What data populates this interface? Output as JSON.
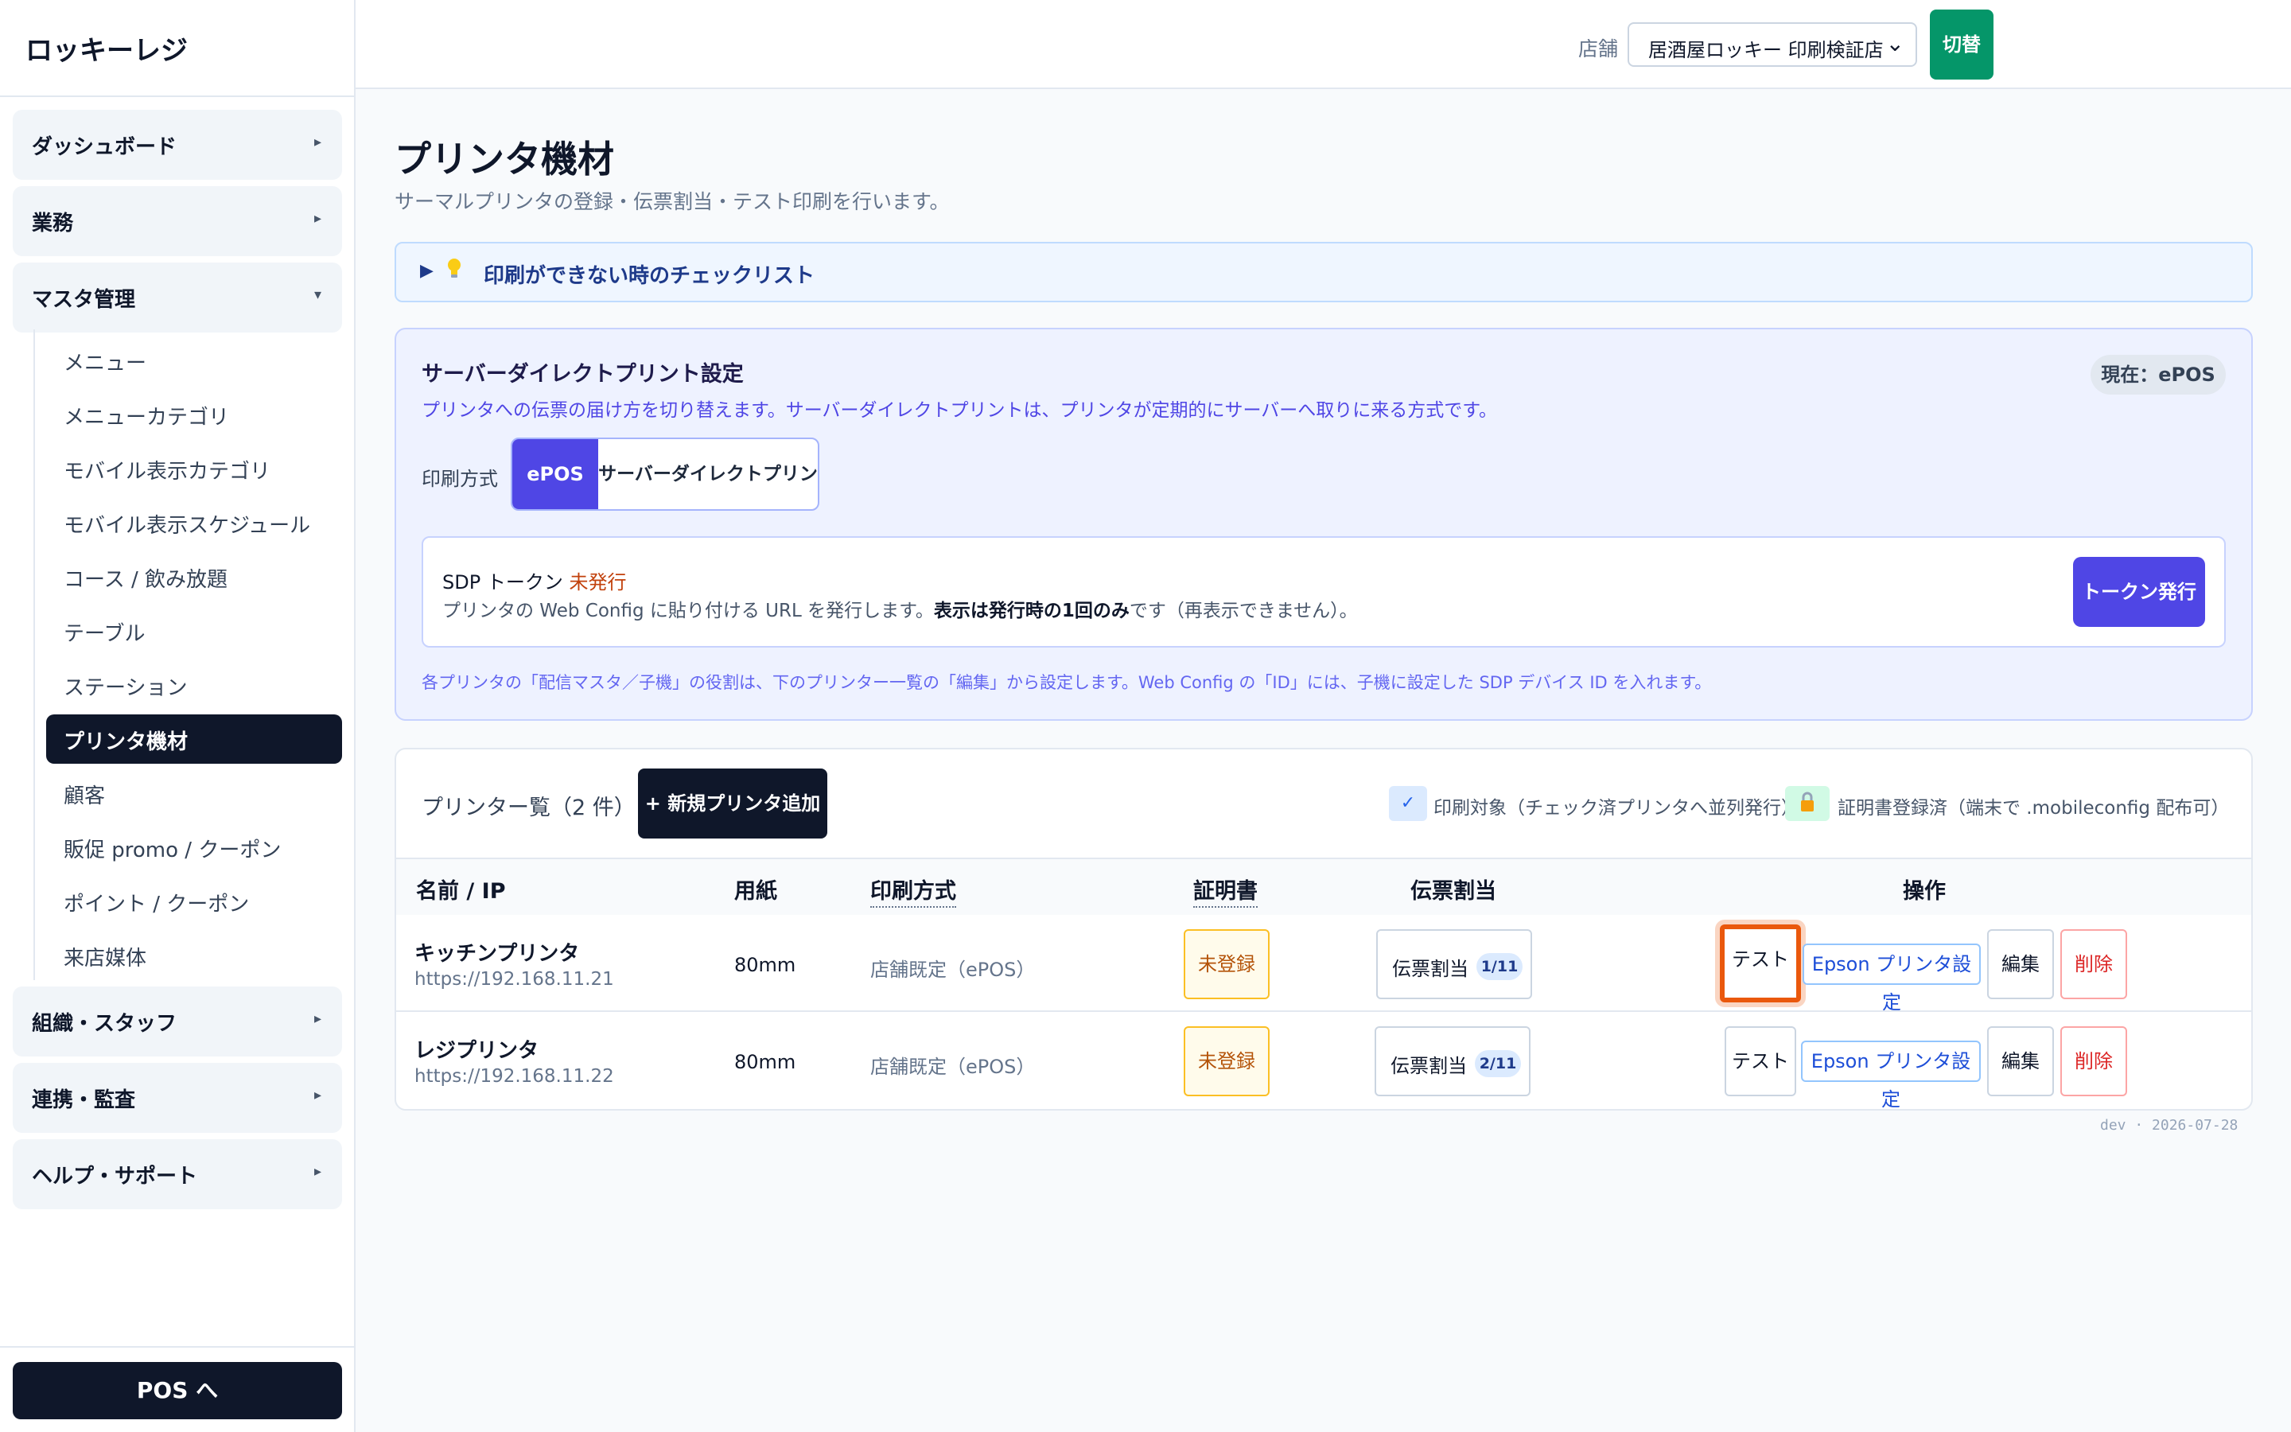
{
  "sidebar": {
    "brand": "ロッキーレジ",
    "groups": [
      {
        "label": "ダッシュボード",
        "arrow": "▸"
      },
      {
        "label": "業務",
        "arrow": "▸"
      },
      {
        "label": "マスタ管理",
        "arrow": "▾"
      },
      {
        "label": "組織・スタッフ",
        "arrow": "▸"
      },
      {
        "label": "連携・監査",
        "arrow": "▸"
      },
      {
        "label": "ヘルプ・サポート",
        "arrow": "▸"
      }
    ],
    "master_items": [
      "メニュー",
      "メニューカテゴリ",
      "モバイル表示カテゴリ",
      "モバイル表示スケジュール",
      "コース / 飲み放題",
      "テーブル",
      "ステーション",
      "プリンタ機材",
      "顧客",
      "販促 promo / クーポン",
      "ポイント / クーポン",
      "来店媒体"
    ],
    "active_item": "プリンタ機材",
    "pos_button": "POS へ"
  },
  "topbar": {
    "store_label": "店舗",
    "store_value": "居酒屋ロッキー 印刷検証店",
    "store_chevron": "⌄",
    "switch_button": "切替"
  },
  "page": {
    "title": "プリンタ機材",
    "subtitle": "サーマルプリンタの登録・伝票割当・テスト印刷を行います。"
  },
  "checklist": {
    "toggle": "▶",
    "label": "印刷ができない時のチェックリスト",
    "icon": "lightbulb-icon"
  },
  "sdp": {
    "title": "サーバーダイレクトプリント設定",
    "description": "プリンタへの伝票の届け方を切り替えます。サーバーダイレクトプリントは、プリンタが定期的にサーバーへ取りに来る方式です。",
    "current_badge": "現在：ePOS",
    "mode_label": "印刷方式",
    "mode_options": [
      "ePOS",
      "サーバーダイレクトプリント"
    ],
    "mode_selected": "ePOS",
    "token_title": "SDP トークン",
    "token_status": "未発行",
    "token_desc_1": "プリンタの Web Config に貼り付ける URL を発行します。",
    "token_desc_bold": "表示は発行時の1回のみ",
    "token_desc_2": "です（再表示できません）。",
    "token_button": "トークン発行",
    "note": "各プリンタの「配信マスタ／子機」の役割は、下のプリンター一覧の「編集」から設定します。Web Config の「ID」には、子機に設定した SDP デバイス ID を入れます。"
  },
  "printer_list": {
    "title": "プリンター覧（2 件）",
    "add_button": "+ 新規プリンタ追加",
    "legend_print": "印刷対象（チェック済プリンタへ並列発行）",
    "legend_print_icon": "✓",
    "legend_cert": "証明書登録済（端末で .mobileconfig 配布可）",
    "legend_cert_icon": "lock-icon",
    "headers": {
      "name": "名前 / IP",
      "paper": "用紙",
      "method": "印刷方式",
      "cert": "証明書",
      "assign": "伝票割当",
      "ops": "操作"
    },
    "rows": [
      {
        "name": "キッチンプリンタ",
        "ip": "https://192.168.11.21",
        "paper": "80mm",
        "method": "店舗既定（ePOS）",
        "cert": "未登録",
        "assign_label": "伝票割当",
        "assign_count": "1/11",
        "test": "テスト",
        "epson": "Epson プリンタ設定",
        "edit": "編集",
        "delete": "削除"
      },
      {
        "name": "レジプリンタ",
        "ip": "https://192.168.11.22",
        "paper": "80mm",
        "method": "店舗既定（ePOS）",
        "cert": "未登録",
        "assign_label": "伝票割当",
        "assign_count": "2/11",
        "test": "テスト",
        "epson": "Epson プリンタ設定",
        "edit": "編集",
        "delete": "削除"
      }
    ]
  },
  "footer": {
    "env_tag": "dev · 2026-07-28"
  },
  "colors": {
    "primary": "#4f46e5",
    "dark": "#0f172a",
    "success": "#059669",
    "warning": "#b45309",
    "danger": "#dc2626",
    "highlight": "#ea580c"
  }
}
